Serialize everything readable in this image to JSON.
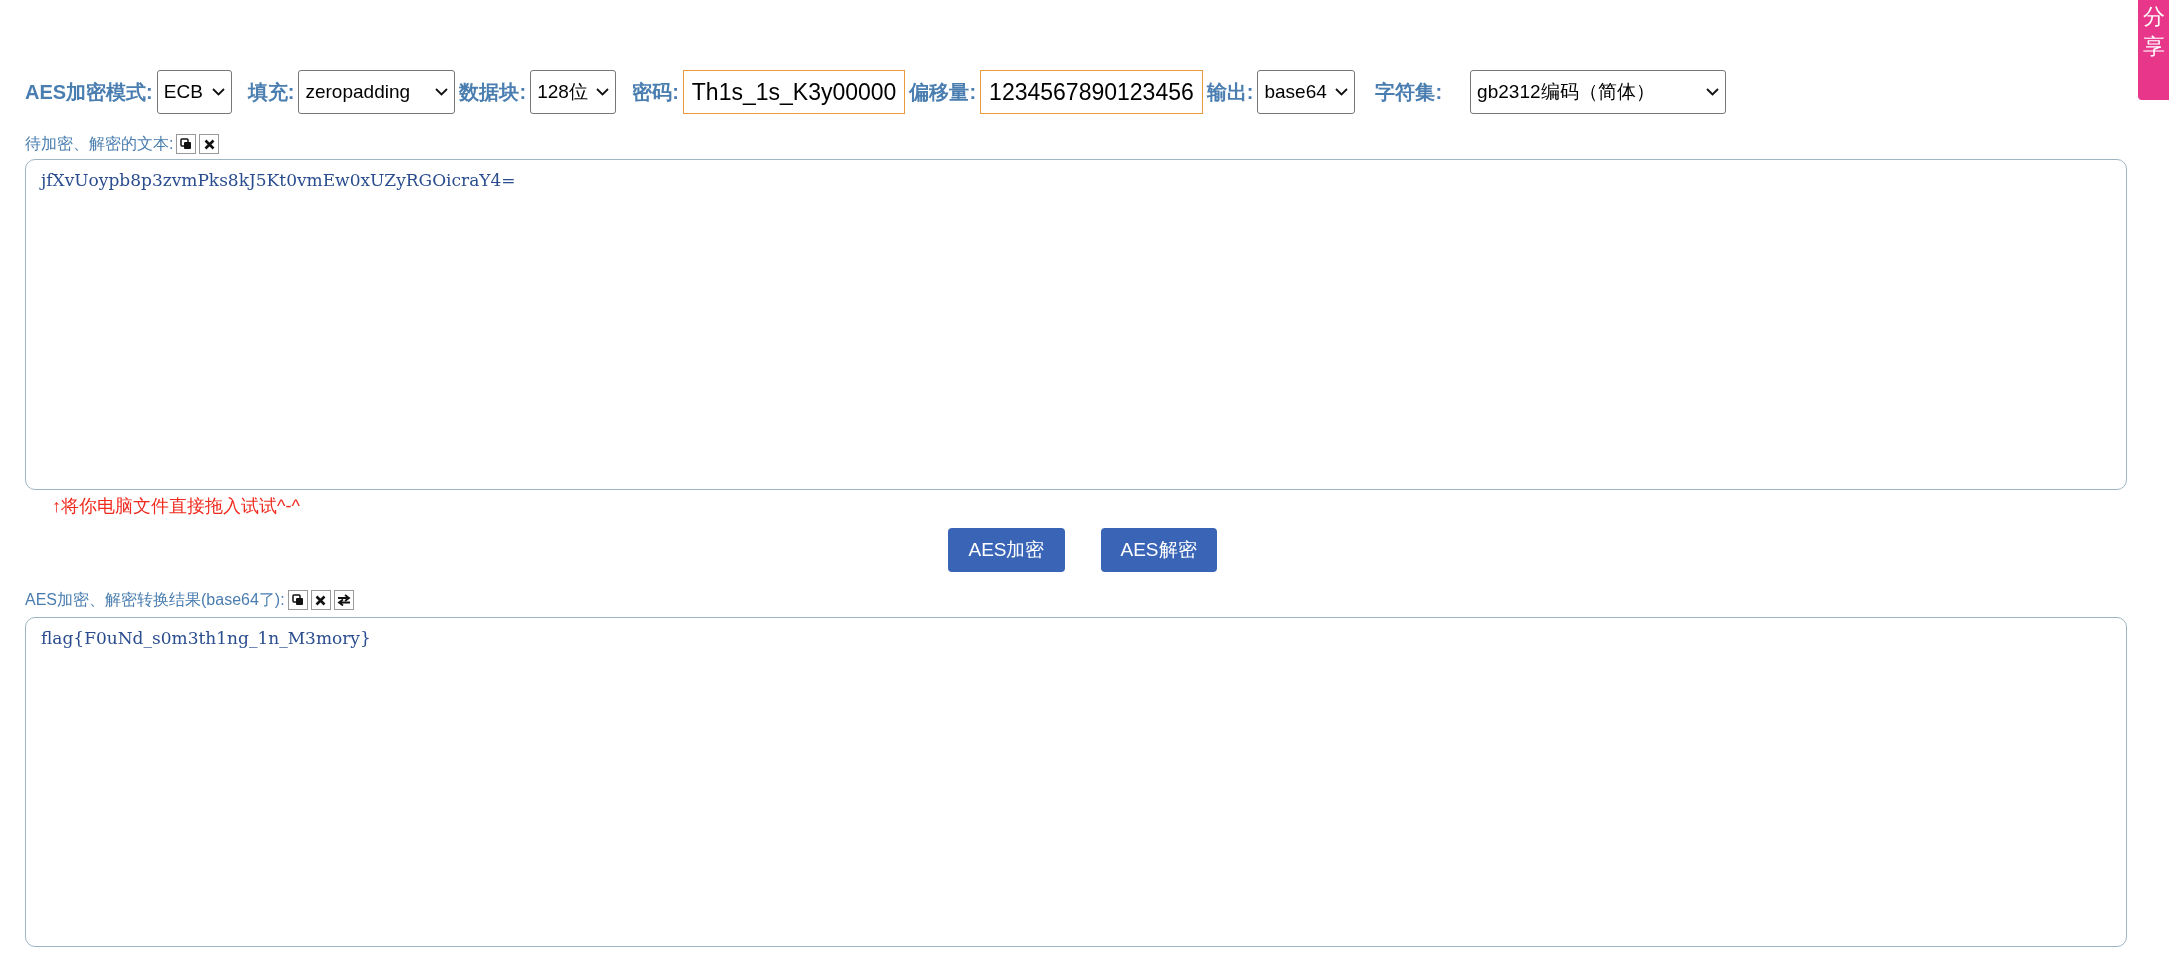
{
  "toolbar": [
    {
      "kind": "select",
      "label": "AES加密模式:",
      "value": "ECB"
    },
    {
      "kind": "select",
      "label": "填充:",
      "value": "zeropadding"
    },
    {
      "kind": "select",
      "label": "数据块:",
      "value": "128位"
    },
    {
      "kind": "input",
      "label": "密码:",
      "value": "Th1s_1s_K3y00000"
    },
    {
      "kind": "input",
      "label": "偏移量:",
      "value": "1234567890123456"
    },
    {
      "kind": "select",
      "label": "输出:",
      "value": "base64"
    },
    {
      "kind": "select",
      "label": "字符集:",
      "value": "gb2312编码（简体）"
    }
  ],
  "input_section": {
    "label": "待加密、解密的文本:",
    "value": "jfXvUoypb8p3zvmPks8kJ5Kt0vmEw0xUZyRGOicraY4=",
    "hint": "↑将你电脑文件直接拖入试试^-^"
  },
  "buttons": [
    "AES加密",
    "AES解密"
  ],
  "output_section": {
    "label": "AES加密、解密转换结果(base64了):",
    "value": "flag{F0uNd_s0m3th1ng_1n_M3mory}"
  },
  "share_tab": {
    "label": "分享"
  }
}
